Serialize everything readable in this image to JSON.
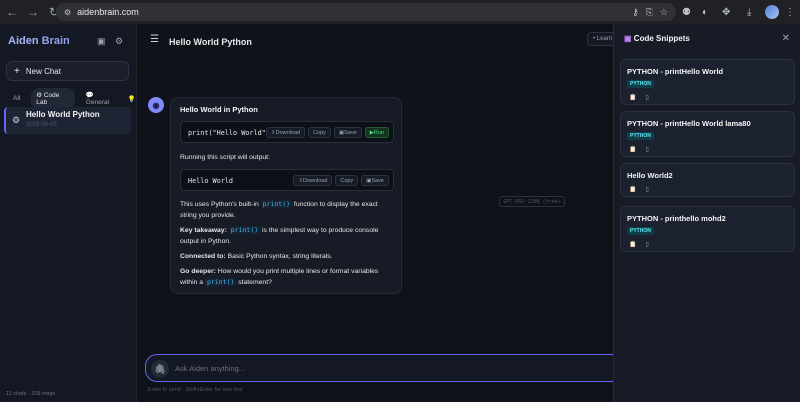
{
  "browser": {
    "url": "aidenbrain.com"
  },
  "sidebar": {
    "brand_main": "Aiden",
    "brand_sub": "Brain",
    "new_chat": "New Chat",
    "filters": [
      {
        "label": "All"
      },
      {
        "label": "Code Lab"
      },
      {
        "label": "General"
      }
    ],
    "chat": {
      "title": "Hello World Python",
      "date": "2025-06-05"
    },
    "footer": "11 chats · 319 msgs"
  },
  "main": {
    "title": "Hello World Python",
    "learn_label": "Learn",
    "message": {
      "heading": "Hello World in Python",
      "code1": "print(\"Hello World\")",
      "output_intro": "Running this script will output:",
      "code2": "Hello World",
      "btn_download": "Download",
      "btn_copy": "Copy",
      "btn_save": "Save",
      "btn_run": "Run",
      "p1_a": "This uses Python's built-in ",
      "p1_code": "print()",
      "p1_b": " function to display the exact string you provide.",
      "p2_label": "Key takeaway:",
      "p2_code": "print()",
      "p2_b": " is the simplest way to produce console output in Python.",
      "p3_label": "Connected to:",
      "p3_b": " Basic Python syntax, string literals.",
      "p4_label": "Go deeper:",
      "p4_b": " How would you print multiple lines or format variables within a ",
      "p4_code": "print()",
      "p4_c": " statement?"
    },
    "model_badge": "GPT-OSS 120B (free)",
    "input_placeholder": "Ask Aiden anything...",
    "input_hint": "Enter to send · Shift+Enter for new line"
  },
  "panel": {
    "title": "Code Snippets",
    "snippets": [
      {
        "title": "PYTHON - printHello World",
        "lang": "PYTHON"
      },
      {
        "title": "PYTHON - printHello World lama80",
        "lang": "PYTHON"
      },
      {
        "title": "Hello World2",
        "lang": ""
      },
      {
        "title": "PYTHON - printhello mohd2",
        "lang": "PYTHON"
      }
    ]
  },
  "colors": {
    "accent": "#6366f1",
    "run": "#4ade80",
    "code": "#38bdf8"
  }
}
